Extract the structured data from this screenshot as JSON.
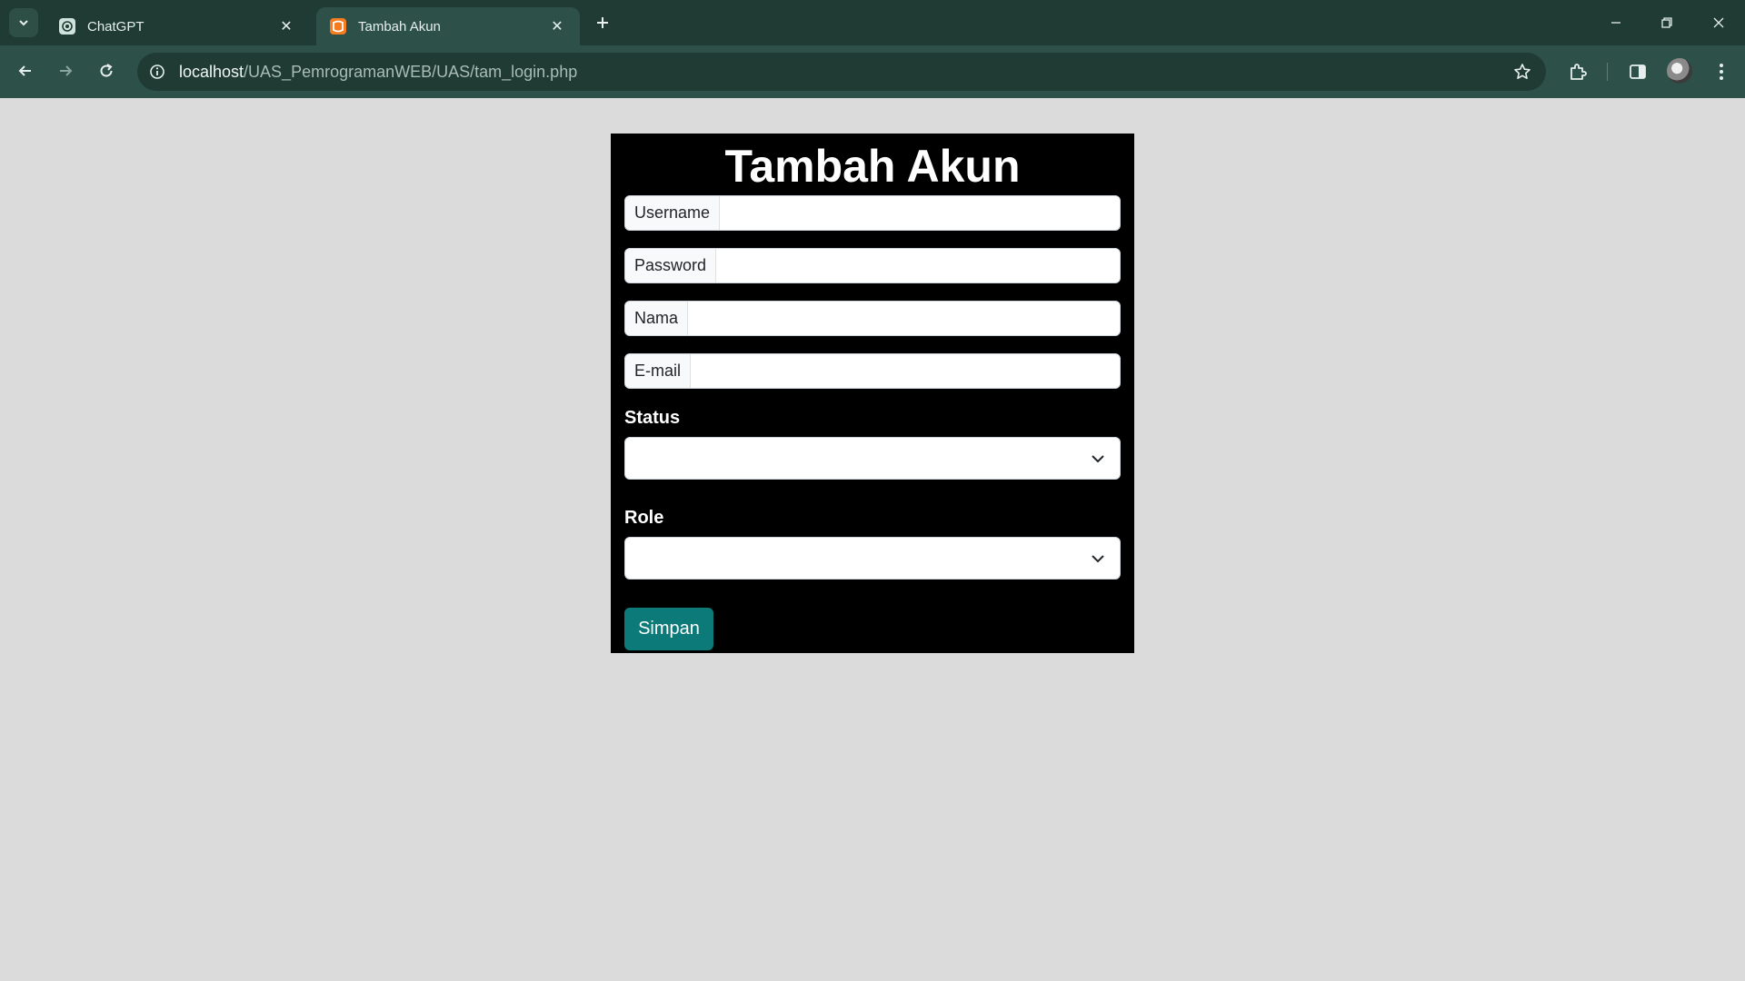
{
  "browser": {
    "tabs": [
      {
        "title": "ChatGPT",
        "favicon": "chatgpt-logo-icon",
        "active": false
      },
      {
        "title": "Tambah Akun",
        "favicon": "xampp-logo-icon",
        "active": true
      }
    ],
    "close_glyph": "✕",
    "address": {
      "host": "localhost",
      "path": "/UAS_PemrogramanWEB/UAS/tam_login.php"
    },
    "colors": {
      "frame": "#1f3b33",
      "toolbar": "#2d5148"
    }
  },
  "page": {
    "title": "Tambah Akun",
    "fields": {
      "username": {
        "label": "Username",
        "value": ""
      },
      "password": {
        "label": "Password",
        "value": ""
      },
      "nama": {
        "label": "Nama",
        "value": ""
      },
      "email": {
        "label": "E-mail",
        "value": ""
      }
    },
    "status": {
      "label": "Status",
      "selected": ""
    },
    "role": {
      "label": "Role",
      "selected": ""
    },
    "submit_label": "Simpan",
    "colors": {
      "background": "#dbdbdb",
      "card": "#000000",
      "button": "#0b7a78"
    }
  }
}
